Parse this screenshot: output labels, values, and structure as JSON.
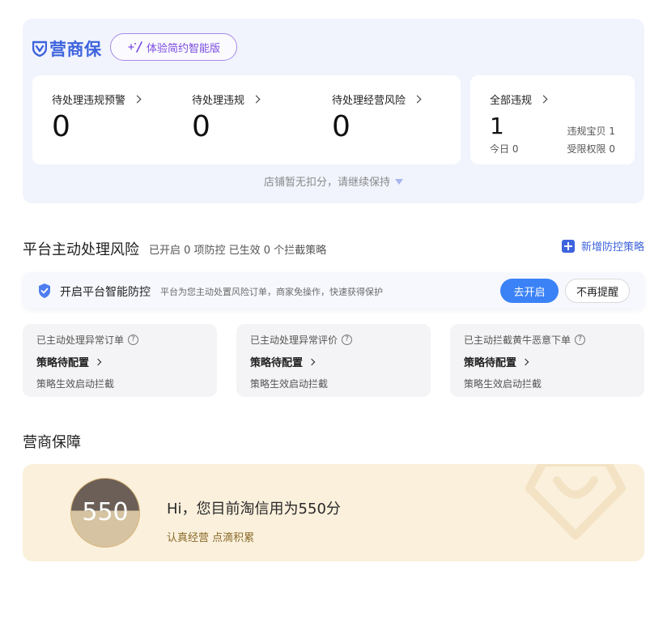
{
  "brand": {
    "logo_text": "营商保",
    "trial_label": "体验简约智能版",
    "accent": "#3e63dd"
  },
  "stats": [
    {
      "label": "待处理违规预警",
      "value": "0"
    },
    {
      "label": "待处理违规",
      "value": "0"
    },
    {
      "label": "待处理经营风险",
      "value": "0"
    }
  ],
  "all_violations": {
    "label": "全部违规",
    "value": "1",
    "today": "今日 0",
    "item_violation": "违规宝贝 1",
    "restricted": "受限权限 0"
  },
  "panel_note": "店铺暂无扣分，请继续保持",
  "risk": {
    "title": "平台主动处理风险",
    "subtitle": "已开启 0 项防控 已生效 0 个拦截策略",
    "add_label": "新增防控策略",
    "protect_title": "开启平台智能防控",
    "protect_desc": "平台为您主动处置风险订单，商家免操作，快速获得保护",
    "open_label": "去开启",
    "dismiss_label": "不再提醒",
    "cards": [
      {
        "title": "已主动处理异常订单",
        "status": "策略待配置",
        "desc": "策略生效启动拦截"
      },
      {
        "title": "已主动处理异常评价",
        "status": "策略待配置",
        "desc": "策略生效启动拦截"
      },
      {
        "title": "已主动拦截黄牛恶意下单",
        "status": "策略待配置",
        "desc": "策略生效启动拦截"
      }
    ]
  },
  "guarantee": {
    "title": "营商保障",
    "credit_score": "550",
    "greeting": "Hi，您目前淘信用为550分",
    "tip": "认真经营 点滴积累"
  }
}
